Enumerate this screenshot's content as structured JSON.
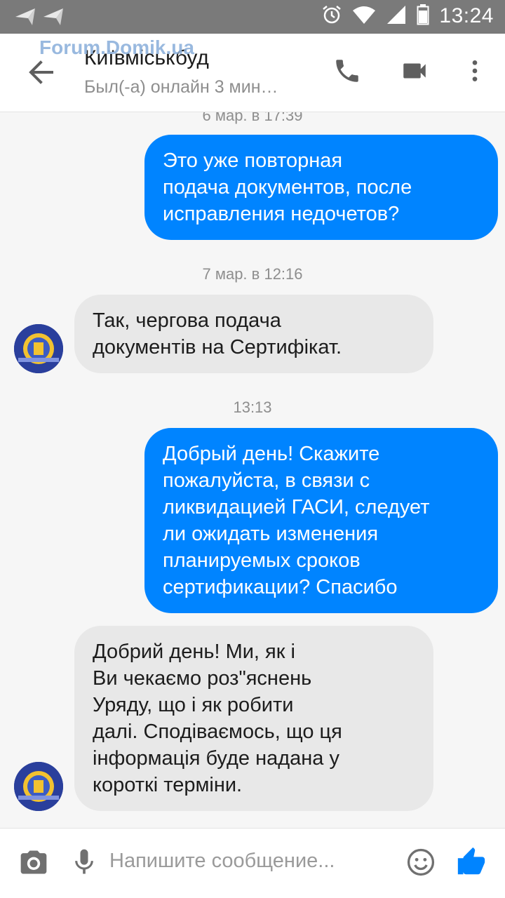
{
  "status_bar": {
    "time": "13:24",
    "icons": [
      "nav-arrow-icon",
      "nav-arrow-icon",
      "alarm-icon",
      "wifi-icon",
      "signal-icon",
      "battery-icon"
    ]
  },
  "header": {
    "watermark": "Forum.Domik.ua",
    "title": "Київміськбуд",
    "subtitle": "Был(-а) онлайн 3 мин…",
    "icons": [
      "back-arrow-icon",
      "phone-icon",
      "video-camera-icon",
      "more-vert-icon"
    ]
  },
  "messages": {
    "ts_top": "6 мар. в 17:39",
    "msg1": [
      "Это уже повторная",
      "подача документов, после",
      "исправления недочетов?"
    ],
    "ts_2": "7 мар. в 12:16",
    "msg2": [
      "Так, чергова подача",
      "документів на Сертифікат."
    ],
    "ts_3": "13:13",
    "msg3": [
      "Добрый день! Скажите",
      "пожалуйста, в связи с",
      "ликвидацией ГАСИ, следует",
      "ли ожидать изменения",
      "планируемых сроков",
      "сертификации? Спасибо"
    ],
    "msg4": [
      "Добрий день! Ми, як і",
      "Ви чекаємо роз\"яснень",
      "Уряду, що і як робити",
      "далі. Сподіваємось, що ця",
      "інформація буде надана у",
      "короткі терміни."
    ]
  },
  "composer": {
    "placeholder": "Напишите сообщение...",
    "icons": [
      "camera-icon",
      "microphone-icon",
      "emoji-icon",
      "thumbs-up-icon"
    ]
  },
  "colors": {
    "outgoing_bubble": "#0084ff",
    "incoming_bubble": "#e8e8e8",
    "accent": "#0084ff",
    "status_bar": "#7a7a7a"
  }
}
